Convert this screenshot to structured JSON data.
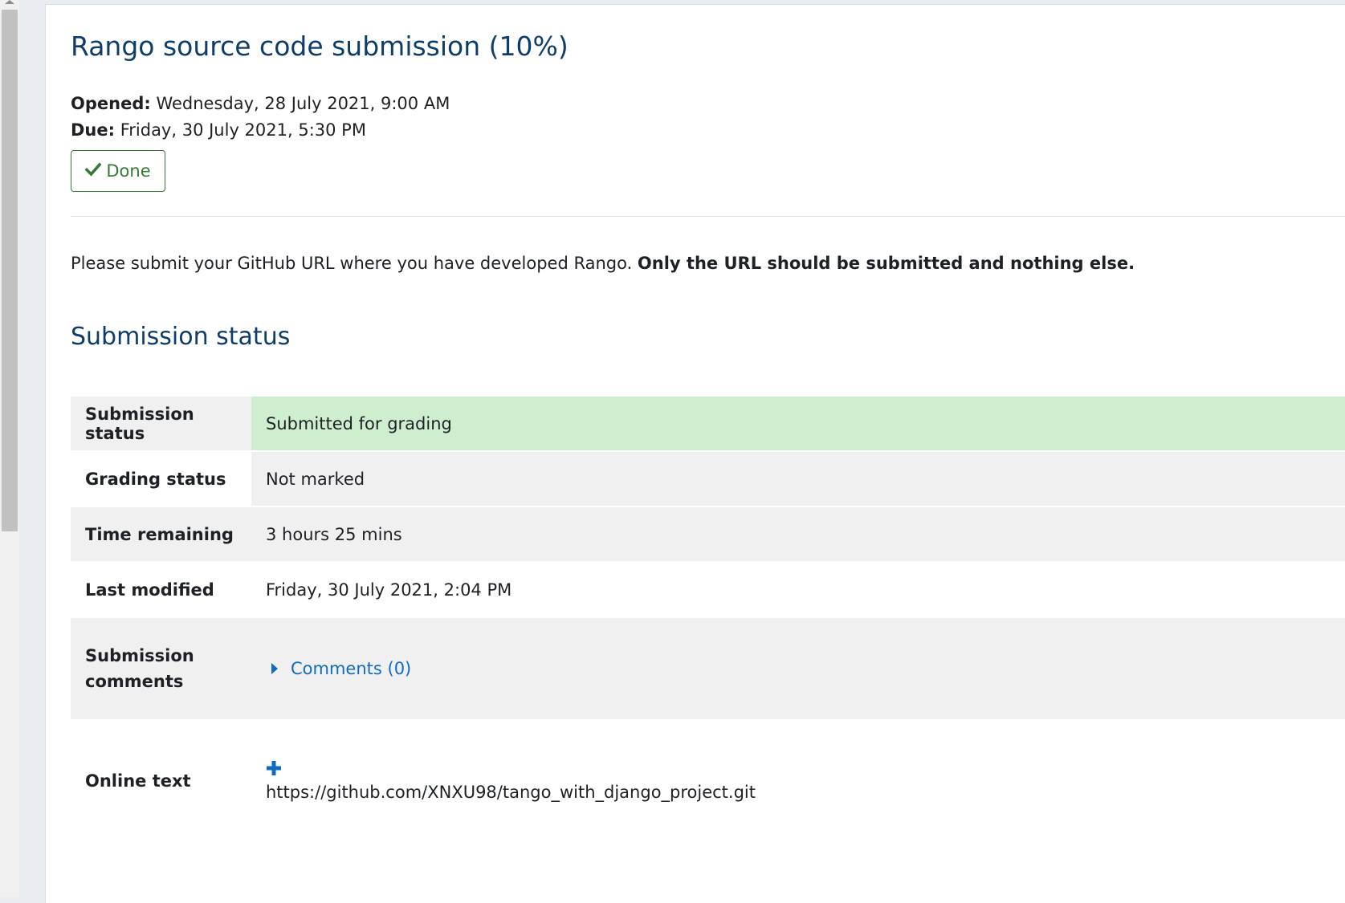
{
  "page": {
    "title": "Rango source code submission (10%)",
    "opened_label": "Opened:",
    "opened_value": "Wednesday, 28 July 2021, 9:00 AM",
    "due_label": "Due:",
    "due_value": "Friday, 30 July 2021, 5:30 PM",
    "done_label": "Done",
    "intro_text": "Please submit your GitHub URL where you have developed Rango. ",
    "intro_bold": "Only the URL should be submitted and nothing else."
  },
  "submission": {
    "heading": "Submission status",
    "rows": [
      {
        "label": "Submission status",
        "value": "Submitted for grading"
      },
      {
        "label": "Grading status",
        "value": "Not marked"
      },
      {
        "label": "Time remaining",
        "value": "3 hours 25 mins"
      },
      {
        "label": "Last modified",
        "value": "Friday, 30 July 2021, 2:04 PM"
      },
      {
        "label": "Submission comments",
        "value": "Comments (0)"
      },
      {
        "label": "Online text",
        "value": "https://github.com/XNXU98/tango_with_django_project.git"
      }
    ]
  },
  "colors": {
    "title": "#0f3d6a",
    "done_green": "#357a32",
    "submitted_bg": "#cfeecf",
    "link": "#0f6cbf"
  },
  "icons": {
    "done": "check-icon",
    "comments": "caret-right-icon",
    "online_text": "plus-icon"
  }
}
